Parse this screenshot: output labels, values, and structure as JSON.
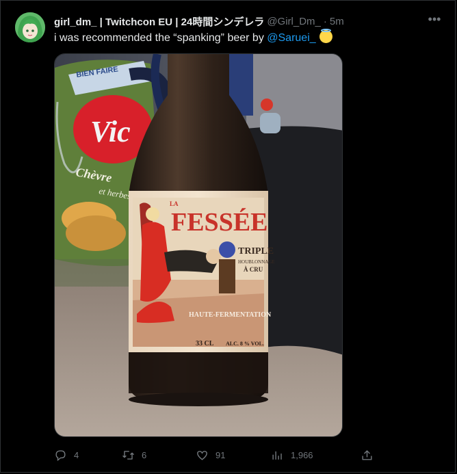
{
  "tweet": {
    "display_name": "girl_dm_ | Twitchcon EU | 24時間シンデレラ",
    "handle": "@Girl_Dm_",
    "separator": "·",
    "time": "5m",
    "more_label": "•••",
    "text_before": "i was recommended the “spanking” beer by ",
    "mention": "@Saruei_",
    "emoji": "smiling-face-with-halo",
    "media": {
      "description_icon": "photo",
      "label": {
        "brand_prefix": "LA",
        "brand": "FESSÉE",
        "style": "TRIPLE",
        "line1": "HOUBLONNAGE",
        "line2": "À CRU",
        "band": "HAUTE-FERMENTATION",
        "volume": "33 CL",
        "abv": "ALC. 8 % VOL."
      },
      "chips_bag": {
        "top": "BIEN FAIRE",
        "brand": "Vic",
        "flavor": "Chèvre",
        "flavor2": "et herbes"
      }
    },
    "actions": {
      "reply_count": "4",
      "retweet_count": "6",
      "like_count": "91",
      "views_count": "1,966"
    }
  },
  "colors": {
    "background": "#000000",
    "text": "#e7e9ea",
    "secondary": "#71767b",
    "link": "#1d9bf0",
    "border": "#2f3336"
  }
}
